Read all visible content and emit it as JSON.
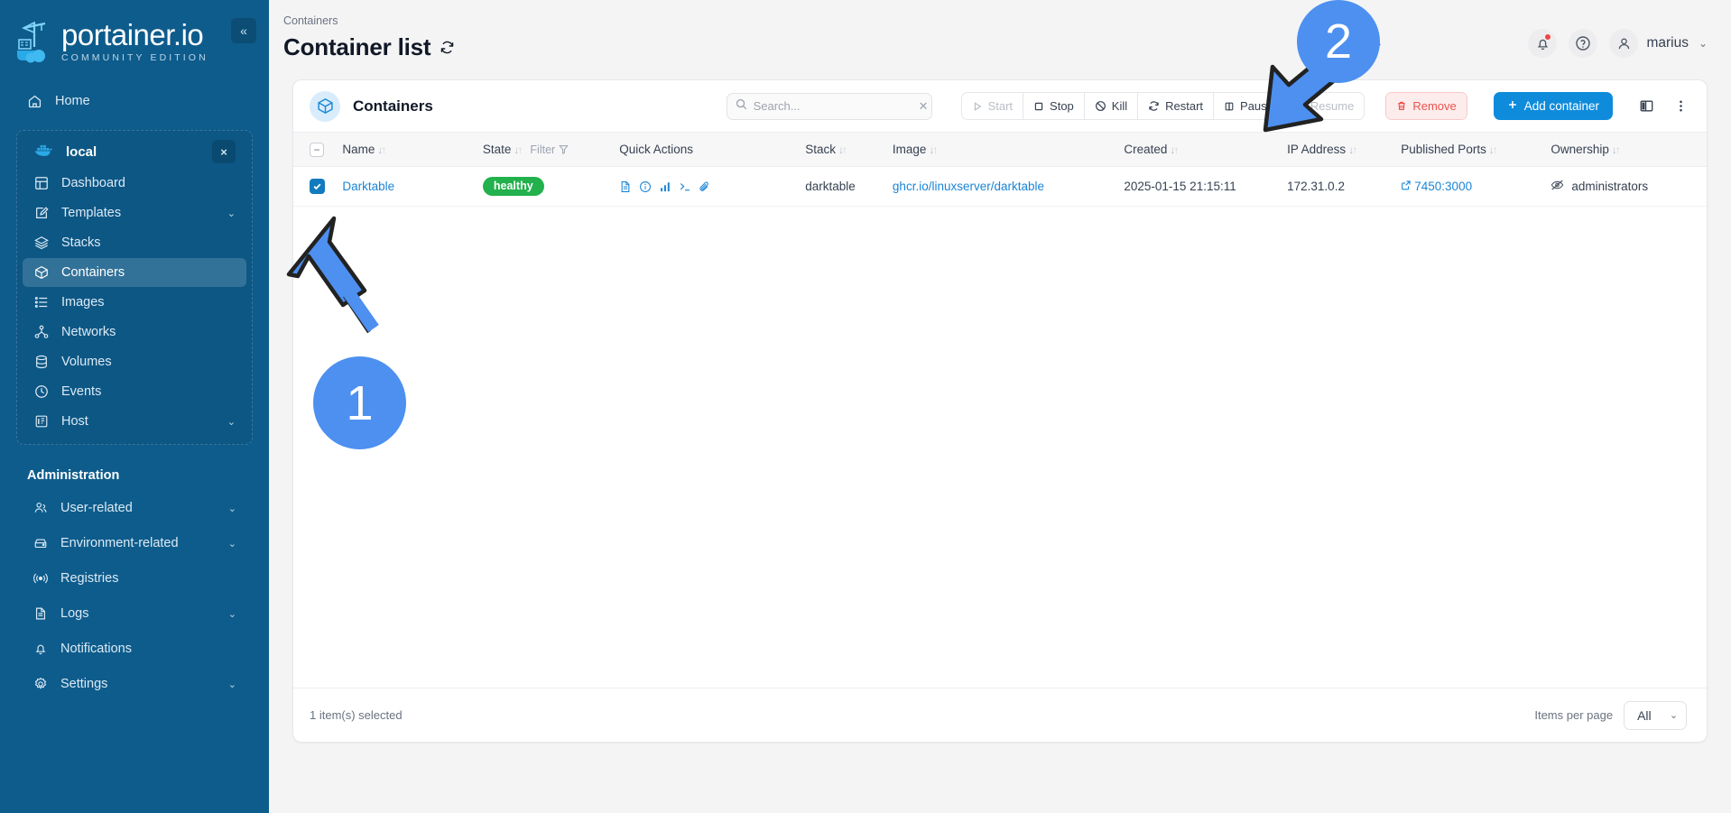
{
  "sidebar": {
    "logo": {
      "title": "portainer.io",
      "subtitle": "COMMUNITY EDITION",
      "icon": "portainer-whale-crane-logo"
    },
    "collapse_label": "«",
    "home": {
      "label": "Home",
      "icon": "home-icon"
    },
    "environment": {
      "name": "local",
      "icon": "docker-whale-icon",
      "close_label": "×"
    },
    "env_items": [
      {
        "label": "Dashboard",
        "icon": "dashboard-icon",
        "active": false,
        "chevron": ""
      },
      {
        "label": "Templates",
        "icon": "templates-pencil-icon",
        "active": false,
        "chevron": "⌄"
      },
      {
        "label": "Stacks",
        "icon": "stacks-layers-icon",
        "active": false,
        "chevron": ""
      },
      {
        "label": "Containers",
        "icon": "container-box-icon",
        "active": true,
        "chevron": ""
      },
      {
        "label": "Images",
        "icon": "images-list-icon",
        "active": false,
        "chevron": ""
      },
      {
        "label": "Networks",
        "icon": "networks-nodes-icon",
        "active": false,
        "chevron": ""
      },
      {
        "label": "Volumes",
        "icon": "volumes-database-icon",
        "active": false,
        "chevron": ""
      },
      {
        "label": "Events",
        "icon": "events-clock-icon",
        "active": false,
        "chevron": ""
      },
      {
        "label": "Host",
        "icon": "host-server-icon",
        "active": false,
        "chevron": "⌄"
      }
    ],
    "admin_title": "Administration",
    "admin_items": [
      {
        "label": "User-related",
        "icon": "users-icon",
        "chevron": "⌄"
      },
      {
        "label": "Environment-related",
        "icon": "environment-box-icon",
        "chevron": "⌄"
      },
      {
        "label": "Registries",
        "icon": "registries-broadcast-icon",
        "chevron": ""
      },
      {
        "label": "Logs",
        "icon": "logs-document-icon",
        "chevron": "⌄"
      },
      {
        "label": "Notifications",
        "icon": "notifications-bell-icon",
        "chevron": ""
      },
      {
        "label": "Settings",
        "icon": "settings-gear-icon",
        "chevron": "⌄"
      }
    ]
  },
  "header": {
    "breadcrumb": "Containers",
    "title": "Container list",
    "refresh_icon": "refresh-icon",
    "bell_icon": "bell-icon",
    "help_icon": "help-circle-icon",
    "avatar_icon": "user-avatar-icon",
    "user_name": "marius",
    "user_chevron": "⌄"
  },
  "card": {
    "icon": "container-box-icon",
    "title": "Containers",
    "search": {
      "placeholder": "Search...",
      "value": "",
      "icon": "search-icon",
      "clear_icon": "clear-x-icon"
    },
    "actions": [
      {
        "label": "Start",
        "icon": "play-icon",
        "disabled": true,
        "danger": false
      },
      {
        "label": "Stop",
        "icon": "stop-square-icon",
        "disabled": false,
        "danger": false
      },
      {
        "label": "Kill",
        "icon": "kill-ban-icon",
        "disabled": false,
        "danger": false
      },
      {
        "label": "Restart",
        "icon": "restart-refresh-icon",
        "disabled": false,
        "danger": false
      },
      {
        "label": "Pause",
        "icon": "pause-icon",
        "disabled": false,
        "danger": false
      },
      {
        "label": "Resume",
        "icon": "play-icon",
        "disabled": true,
        "danger": false
      }
    ],
    "remove": {
      "label": "Remove",
      "icon": "trash-icon"
    },
    "add_container": {
      "label": "Add container",
      "icon": "plus-icon"
    },
    "columns_icon": "column-layout-icon",
    "kebab_icon": "more-vertical-icon"
  },
  "table": {
    "select_all_icon": "minus-icon",
    "columns": [
      {
        "label": "Name",
        "sortable": true
      },
      {
        "label": "State",
        "sortable": true,
        "filter": "Filter",
        "filter_icon": "funnel-icon"
      },
      {
        "label": "Quick Actions",
        "sortable": false
      },
      {
        "label": "Stack",
        "sortable": true
      },
      {
        "label": "Image",
        "sortable": true
      },
      {
        "label": "Created",
        "sortable": true
      },
      {
        "label": "IP Address",
        "sortable": true
      },
      {
        "label": "Published Ports",
        "sortable": true
      },
      {
        "label": "Ownership",
        "sortable": true
      }
    ],
    "rows": [
      {
        "selected": true,
        "name": "Darktable",
        "state": "healthy",
        "quick_actions": [
          "logs-icon",
          "inspect-info-icon",
          "stats-chart-icon",
          "console-terminal-icon",
          "attach-paperclip-icon"
        ],
        "stack": "darktable",
        "image": "ghcr.io/linuxserver/darktable",
        "created": "2025-01-15 21:15:11",
        "ip_address": "172.31.0.2",
        "published_ports": "7450:3000",
        "ports_icon": "external-link-icon",
        "ownership": "administrators",
        "ownership_icon": "eye-slash-icon"
      }
    ]
  },
  "footer": {
    "selected_text": "1 item(s) selected",
    "items_per_page_label": "Items per page",
    "items_per_page_value": "All",
    "chevron": "⌄"
  },
  "annotations": [
    {
      "number": "1",
      "target": "row-checkbox"
    },
    {
      "number": "2",
      "target": "restart-button"
    }
  ],
  "colors": {
    "sidebar_bg": "#0e5c8c",
    "accent_blue": "#0f8bdb",
    "link_blue": "#1a85d6",
    "healthy_green": "#22b14c",
    "danger_red": "#e8534f",
    "annotation_blue": "#4d90f0"
  }
}
